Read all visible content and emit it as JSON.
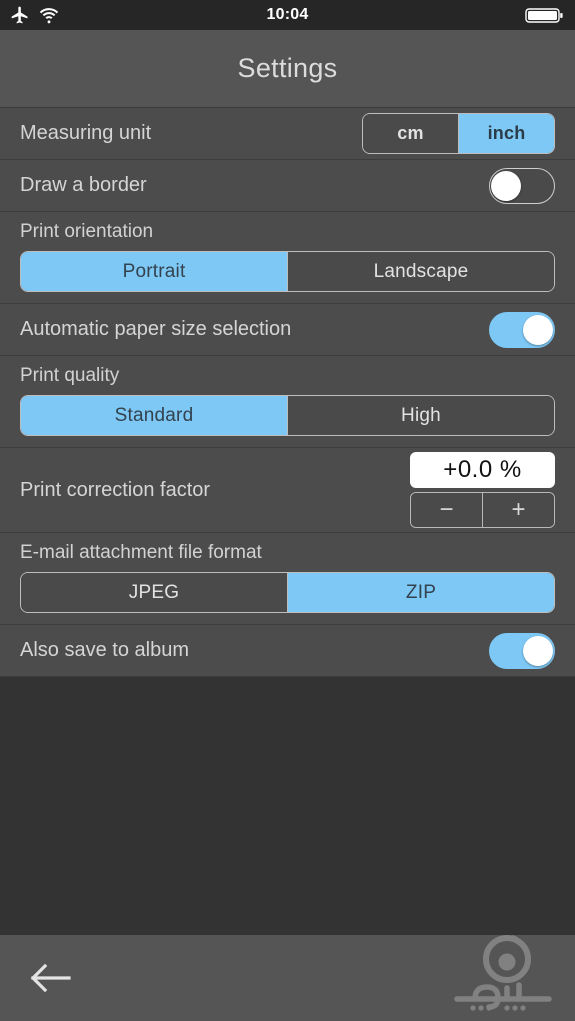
{
  "status_bar": {
    "airplane_icon": "airplane-mode-icon",
    "wifi_icon": "wifi-icon",
    "time": "10:04",
    "battery_icon": "battery-full-icon"
  },
  "header": {
    "title": "Settings"
  },
  "colors": {
    "accent_blue": "#7ec8f5",
    "row_background": "#4c4c4c",
    "header_background": "#555555",
    "page_background": "#333333",
    "label_text": "#d5d5d5",
    "active_segment_text": "#33424e"
  },
  "settings": {
    "measuring_unit": {
      "label": "Measuring unit",
      "options": [
        "cm",
        "inch"
      ],
      "selected": "inch"
    },
    "draw_border": {
      "label": "Draw a border",
      "state": "off"
    },
    "print_orientation": {
      "label": "Print orientation",
      "options": [
        "Portrait",
        "Landscape"
      ],
      "selected": "Portrait"
    },
    "automatic_paper_size": {
      "label": "Automatic paper size selection",
      "state": "on"
    },
    "print_quality": {
      "label": "Print quality",
      "options": [
        "Standard",
        "High"
      ],
      "selected": "Standard"
    },
    "print_correction_factor": {
      "label": "Print correction factor",
      "value": "+0.0 %",
      "decrement_label": "−",
      "increment_label": "+"
    },
    "email_attachment_format": {
      "label": "E-mail attachment file format",
      "options": [
        "JPEG",
        "ZIP"
      ],
      "selected": "ZIP"
    },
    "also_save_to_album": {
      "label": "Also save to album",
      "state": "on"
    }
  },
  "bottom_bar": {
    "back_icon": "back-arrow-icon",
    "watermark_icon": "app-watermark-logo"
  }
}
